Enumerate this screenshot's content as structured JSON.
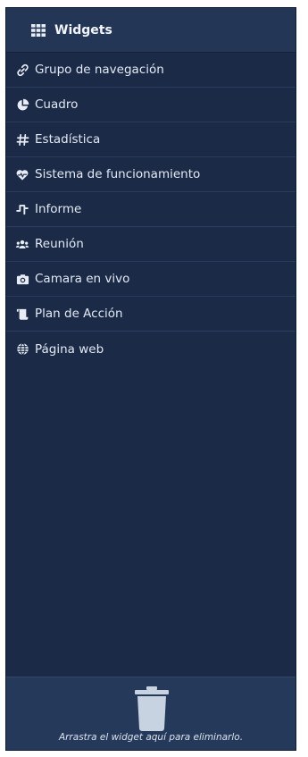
{
  "header": {
    "title": "Widgets",
    "icon": "grid-icon"
  },
  "widgets": [
    {
      "label": "Grupo de navegación",
      "icon": "link-icon"
    },
    {
      "label": "Cuadro",
      "icon": "pie-chart-icon"
    },
    {
      "label": "Estadística",
      "icon": "hashtag-icon"
    },
    {
      "label": "Sistema de funcionamiento",
      "icon": "heartbeat-icon"
    },
    {
      "label": "Informe",
      "icon": "waveform-icon"
    },
    {
      "label": "Reunión",
      "icon": "users-icon"
    },
    {
      "label": "Camara en vivo",
      "icon": "camera-icon"
    },
    {
      "label": "Plan de Acción",
      "icon": "scroll-icon"
    },
    {
      "label": "Página web",
      "icon": "globe-icon"
    }
  ],
  "trash": {
    "hint": "Arrastra el widget aquí para eliminarlo.",
    "icon": "trash-icon"
  },
  "colors": {
    "panel_bg": "#1b2b47",
    "header_bg": "#243656",
    "trash_bg": "#25395a",
    "text": "#e3e9f3"
  }
}
